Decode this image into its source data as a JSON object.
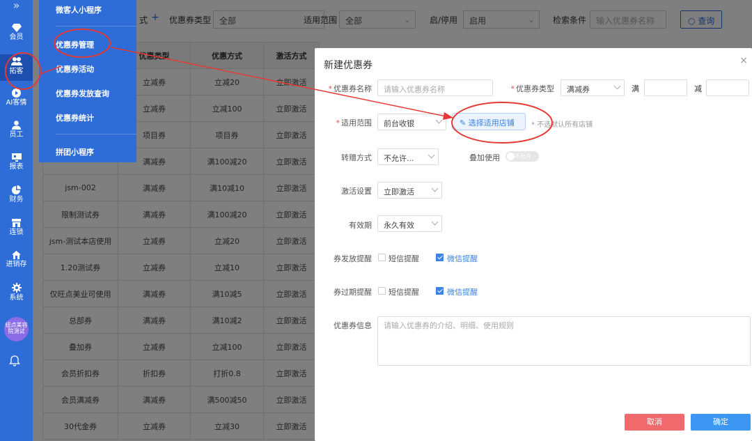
{
  "nav": {
    "top_icon": "»",
    "items": [
      {
        "label": "会员",
        "icon": "diamond-icon"
      },
      {
        "label": "拓客",
        "icon": "users-icon"
      },
      {
        "label": "AI客情",
        "icon": "play-icon"
      },
      {
        "label": "员工",
        "icon": "person-icon"
      },
      {
        "label": "报表",
        "icon": "monitor-icon"
      },
      {
        "label": "财务",
        "icon": "pie-icon"
      },
      {
        "label": "连锁",
        "icon": "store-icon"
      },
      {
        "label": "进销存",
        "icon": "house-icon"
      },
      {
        "label": "系统",
        "icon": "gear-icon"
      }
    ],
    "avatar_text": "纽点美容\n院测试",
    "bell_icon": "bell-icon",
    "active_index": 1
  },
  "submenu": {
    "items": [
      "微客人小程序",
      "优惠券管理",
      "优惠券活动",
      "优惠券发放查询",
      "优惠券统计",
      "拼团小程序"
    ]
  },
  "filters": {
    "method_label": "式",
    "plus": "+",
    "type_label": "优惠券类型",
    "type_value": "全部",
    "scope_label": "适用范围",
    "scope_value": "全部",
    "status_label": "启/停用",
    "status_value": "启用",
    "search_label": "检索条件",
    "search_placeholder": "输入优惠券名称",
    "query_button": "查询"
  },
  "table": {
    "headers": [
      "",
      "优惠类型",
      "优惠方式",
      "激活方式"
    ],
    "rows": [
      [
        "",
        "立减券",
        "立减20",
        "立即激活"
      ],
      [
        "",
        "立减券",
        "立减100",
        "立即激活"
      ],
      [
        "",
        "项目券",
        "项目券",
        "立即激活"
      ],
      [
        "",
        "满减券",
        "满100减20",
        "立即激活"
      ],
      [
        "jsm-002",
        "满减券",
        "满10减10",
        "立即激活"
      ],
      [
        "限制测试券",
        "满减券",
        "满100减20",
        "立即激活"
      ],
      [
        "jsm-测试本店使用",
        "立减券",
        "立减20",
        "立即激活"
      ],
      [
        "1.20测试券",
        "立减券",
        "立减10",
        "立即激活"
      ],
      [
        "仅旺点美业可使用",
        "满减券",
        "满10减5",
        "立即激活"
      ],
      [
        "总部券",
        "满减券",
        "满10减2",
        "立即激活"
      ],
      [
        "叠加券",
        "立减券",
        "立减100",
        "立即激活"
      ],
      [
        "会员折扣券",
        "折扣券",
        "打折0.8",
        "立即激活"
      ],
      [
        "会员满减券",
        "满减券",
        "满500减50",
        "立即激活"
      ],
      [
        "30代金券",
        "立减券",
        "立减30",
        "立即激活"
      ]
    ]
  },
  "modal": {
    "title": "新建优惠券",
    "close": "×",
    "name_label": "优惠券名称",
    "name_placeholder": "请输入优惠券名称",
    "type_label": "优惠券类型",
    "type_value": "满减券",
    "full_label": "满",
    "minus_label": "减",
    "scope_label": "适用范围",
    "scope_value": "前台收银",
    "store_button": "选择适用店铺",
    "store_hint": "* 不选默认所有店铺",
    "transfer_label": "转赠方式",
    "transfer_value": "不允许...",
    "stack_label": "叠加使用",
    "stack_toggle": "不允许",
    "activate_label": "激活设置",
    "activate_value": "立即激活",
    "validity_label": "有效期",
    "validity_value": "永久有效",
    "issue_remind_label": "券发放提醒",
    "expire_remind_label": "券过期提醒",
    "sms_label": "短信提醒",
    "wechat_label": "微信提醒",
    "info_label": "优惠券信息",
    "info_placeholder": "请输入优惠券的介绍、明细、使用规则",
    "cancel": "取消",
    "ok": "确定"
  }
}
